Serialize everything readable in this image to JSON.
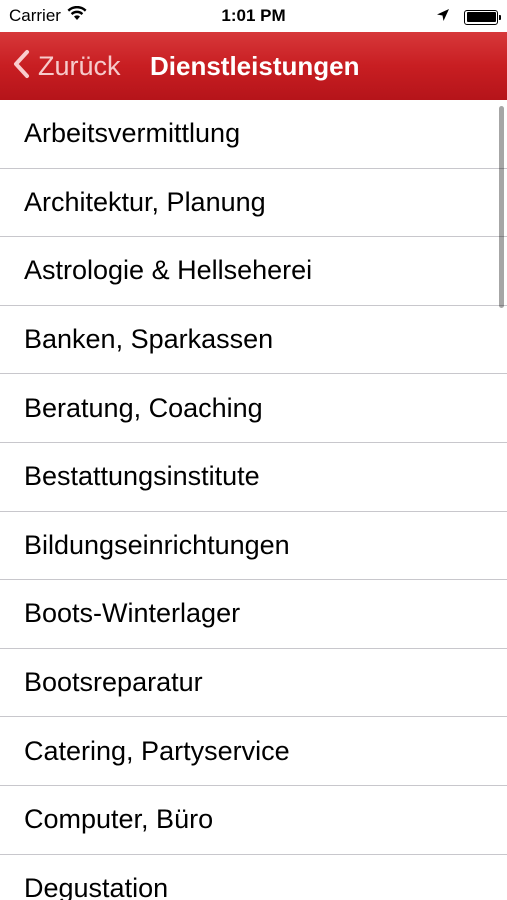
{
  "status_bar": {
    "carrier": "Carrier",
    "time": "1:01 PM"
  },
  "nav": {
    "back_label": "Zurück",
    "title": "Dienstleistungen"
  },
  "list": {
    "items": [
      "Arbeitsvermittlung",
      "Architektur, Planung",
      "Astrologie & Hellseherei",
      "Banken, Sparkassen",
      "Beratung, Coaching",
      "Bestattungsinstitute",
      "Bildungseinrichtungen",
      "Boots-Winterlager",
      "Bootsreparatur",
      "Catering, Partyservice",
      "Computer, Büro",
      "Degustation"
    ]
  },
  "colors": {
    "nav_bar": "#c81e22",
    "separator": "#c8c7cc"
  },
  "icons": {
    "wifi": "wifi-icon",
    "location": "location-arrow-icon",
    "battery": "battery-icon",
    "back": "chevron-left-icon"
  }
}
